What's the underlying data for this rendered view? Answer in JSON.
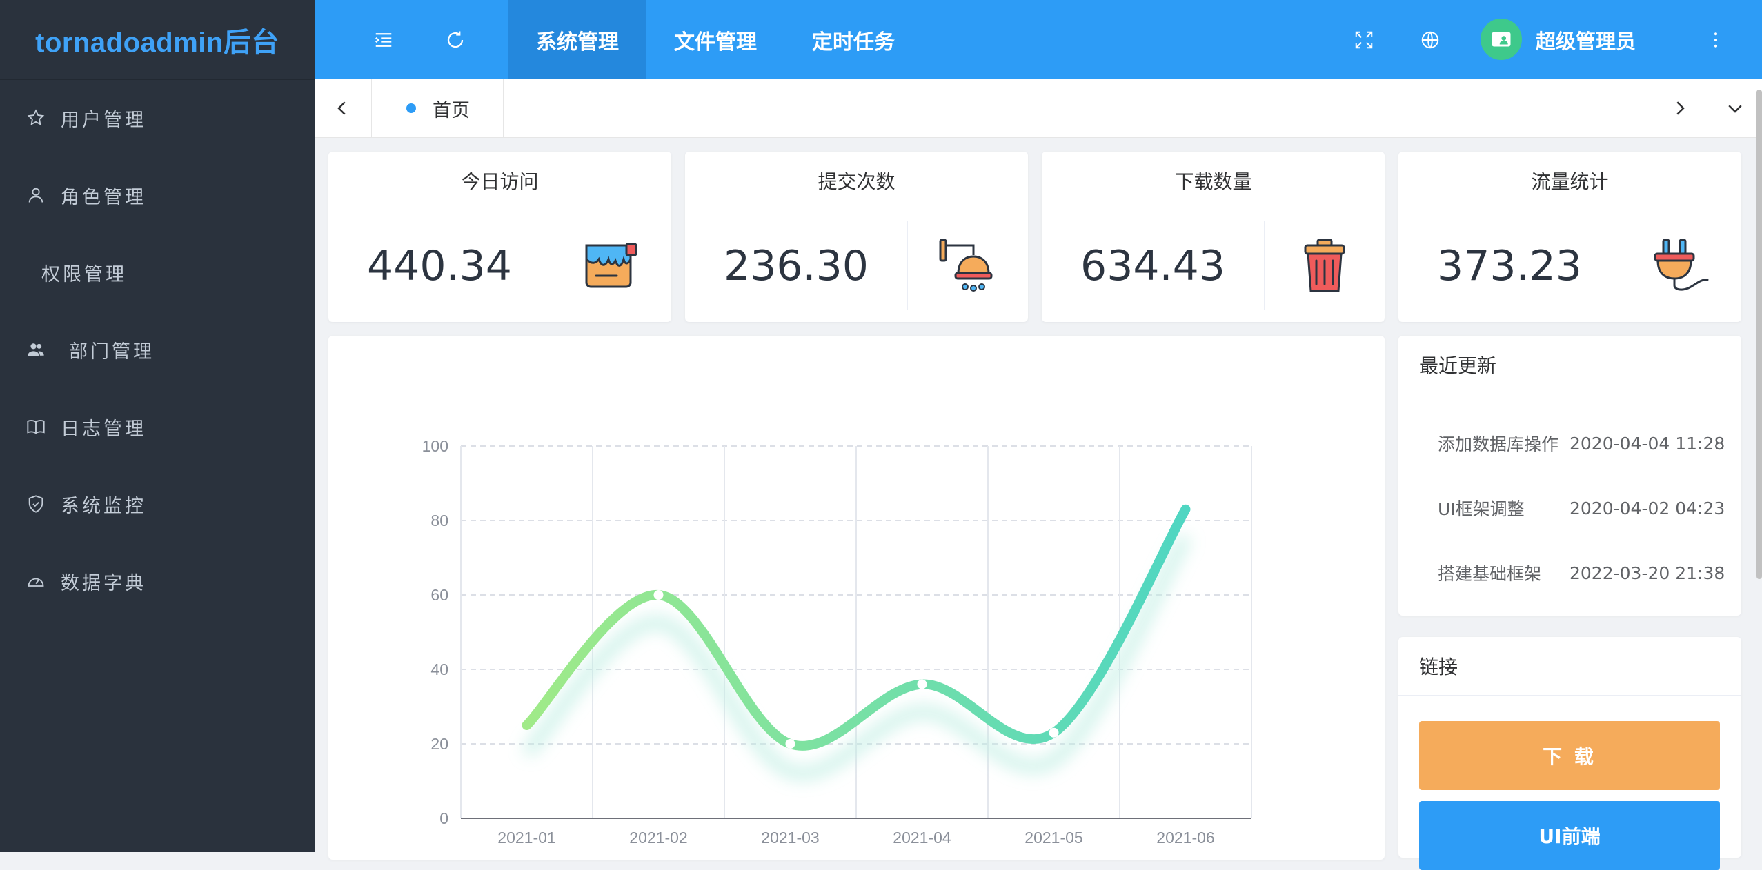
{
  "app": {
    "logo_text": "tornadoadmin后台"
  },
  "sidebar": {
    "items": [
      {
        "label": "用户管理",
        "icon": "star-icon"
      },
      {
        "label": "角色管理",
        "icon": "user-icon"
      },
      {
        "label": "权限管理",
        "icon": ""
      },
      {
        "label": "部门管理",
        "icon": "users-icon"
      },
      {
        "label": "日志管理",
        "icon": "book-icon"
      },
      {
        "label": "系统监控",
        "icon": "shield-icon"
      },
      {
        "label": "数据字典",
        "icon": "dashboard-icon"
      }
    ]
  },
  "header": {
    "tabs": [
      {
        "label": "系统管理",
        "active": true
      },
      {
        "label": "文件管理",
        "active": false
      },
      {
        "label": "定时任务",
        "active": false
      }
    ],
    "username": "超级管理员"
  },
  "tagbar": {
    "home_label": "首页"
  },
  "stats": [
    {
      "title": "今日访问",
      "value": "440.34",
      "icon": "paint-bucket-icon"
    },
    {
      "title": "提交次数",
      "value": "236.30",
      "icon": "shower-icon"
    },
    {
      "title": "下载数量",
      "value": "634.43",
      "icon": "trash-can-icon"
    },
    {
      "title": "流量统计",
      "value": "373.23",
      "icon": "plug-icon"
    }
  ],
  "recent": {
    "title": "最近更新",
    "items": [
      {
        "text": "添加数据库操作",
        "date": "2020-04-04 11:28"
      },
      {
        "text": "UI框架调整",
        "date": "2020-04-02 04:23"
      },
      {
        "text": "搭建基础框架",
        "date": "2022-03-20 21:38"
      }
    ]
  },
  "links": {
    "title": "链接",
    "buttons": [
      {
        "label": "下 载",
        "color": "#f5ab5b"
      },
      {
        "label": "UI前端",
        "color": "#2d9cf6"
      }
    ]
  },
  "chart_data": {
    "type": "line",
    "categories": [
      "2021-01",
      "2021-02",
      "2021-03",
      "2021-04",
      "2021-05",
      "2021-06"
    ],
    "series": [
      {
        "values": [
          25,
          60,
          20,
          36,
          23,
          83
        ]
      }
    ],
    "ylim": [
      0,
      100
    ],
    "yticks": [
      "0",
      "20",
      "40",
      "60",
      "80",
      "100"
    ],
    "smooth": true,
    "grid": true,
    "gradient": [
      "#a0ea88",
      "#4fd6c2"
    ]
  }
}
